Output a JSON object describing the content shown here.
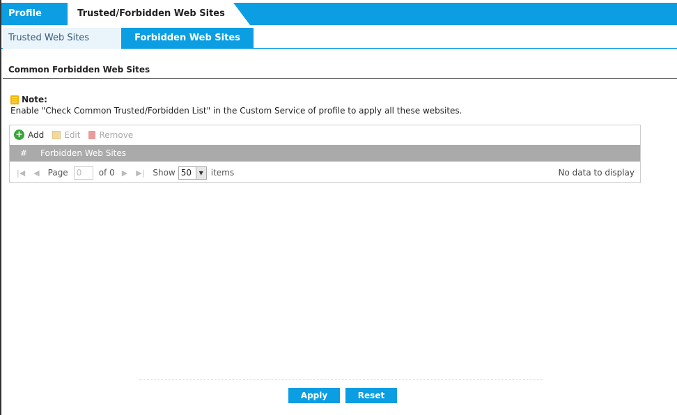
{
  "tabs": {
    "profile": "Profile",
    "trusted_forbidden": "Trusted/Forbidden Web Sites"
  },
  "subtabs": {
    "trusted": "Trusted Web Sites",
    "forbidden": "Forbidden Web Sites"
  },
  "section": {
    "title": "Common Forbidden Web Sites"
  },
  "note": {
    "heading": "Note:",
    "text": "Enable \"Check Common Trusted/Forbidden List\" in the Custom Service of profile to apply all these websites."
  },
  "toolbar": {
    "add": "Add",
    "edit": "Edit",
    "remove": "Remove"
  },
  "table": {
    "columns": [
      "#",
      "Forbidden Web Sites"
    ],
    "rows": []
  },
  "pager": {
    "page_label": "Page",
    "page_value": "0",
    "of_label": "of 0",
    "show_label": "Show",
    "show_value": "50",
    "items_label": "items",
    "status": "No data to display"
  },
  "buttons": {
    "apply": "Apply",
    "reset": "Reset"
  },
  "colors": {
    "accent": "#0b9ee3",
    "header_gray": "#aaaaaa",
    "add_green": "#3aa53a"
  }
}
